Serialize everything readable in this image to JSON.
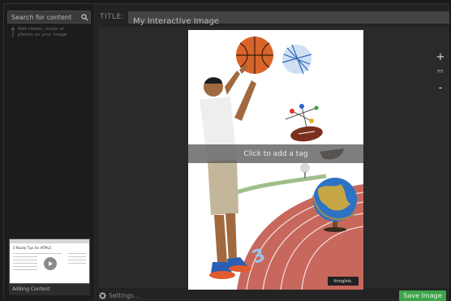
{
  "sidebar": {
    "search": {
      "text": "Search for content",
      "icon": "search-icon"
    },
    "hint": "Add videos, music or photos on your image",
    "thumbnail": {
      "title": "5 Ready Tips for HTML5",
      "caption": "Adding Content"
    }
  },
  "header": {
    "title_label": "TITLE:",
    "title_value": "My Interactive Image"
  },
  "canvas": {
    "tag_prompt": "Click to add a tag",
    "watermark": "thinglink.",
    "zoom": {
      "in": "+",
      "fit": "FIT",
      "out": "-"
    }
  },
  "footer": {
    "settings_label": "Settings...",
    "save_label": "Save Image"
  },
  "colors": {
    "save_button": "#3ea44a",
    "background": "#232323",
    "sidebar": "#1c1c1c"
  }
}
